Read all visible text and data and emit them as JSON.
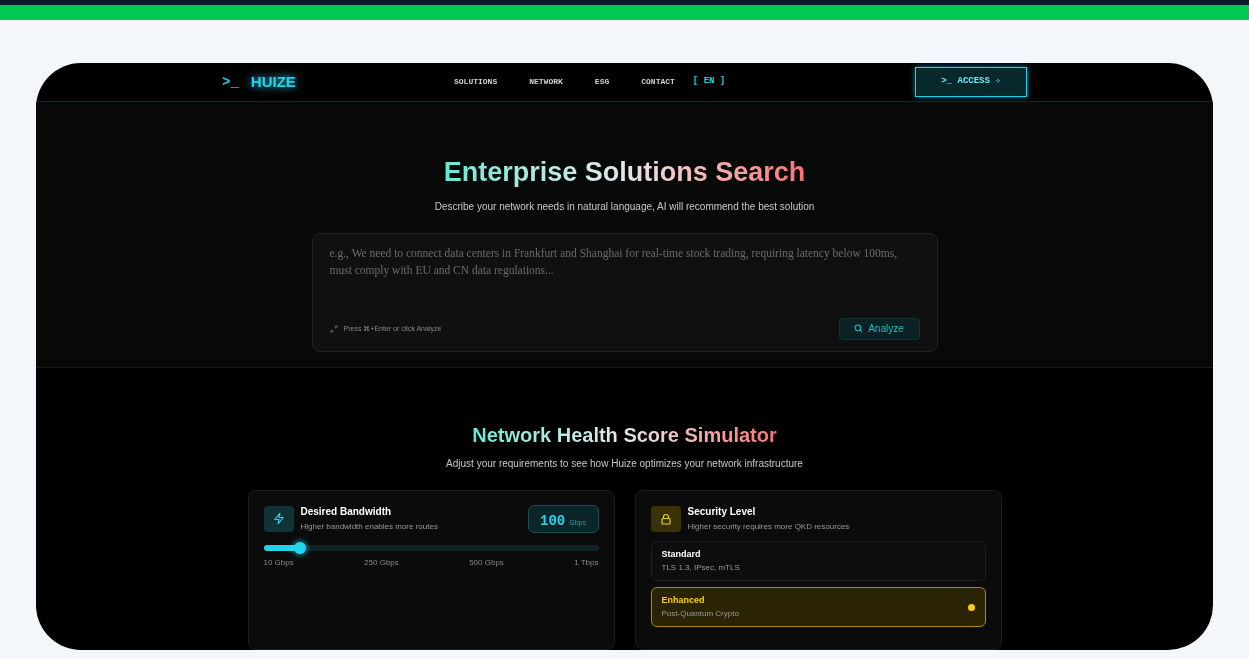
{
  "header": {
    "logo_prompt": ">_",
    "logo": "HUIZE",
    "nav": [
      {
        "label": "SOLUTIONS"
      },
      {
        "label": "NETWORK"
      },
      {
        "label": "ESG"
      },
      {
        "label": "CONTACT"
      }
    ],
    "language": "[ EN ]",
    "access_button": ">_ ACCESS ✧"
  },
  "search": {
    "title": "Enterprise Solutions Search",
    "subtitle": "Describe your network needs in natural language, AI will recommend the best solution",
    "placeholder": "e.g., We need to connect data centers in Frankfurt and Shanghai for real-time stock trading, requiring latency below 100ms, must comply with EU and CN data regulations...",
    "hint": "Press ⌘+Enter or click Analyze",
    "button": "Analyze"
  },
  "simulator": {
    "title": "Network Health Score Simulator",
    "subtitle": "Adjust your requirements to see how Huize optimizes your network infrastructure",
    "bandwidth": {
      "title": "Desired Bandwidth",
      "description": "Higher bandwidth enables more routes",
      "value": "100",
      "unit": "Gbps",
      "level": 0.11,
      "ticks": [
        "10 Gbps",
        "250 Gbps",
        "500 Gbps",
        "1 Tbps"
      ]
    },
    "security": {
      "title": "Security Level",
      "description": "Higher security requires more QKD resources",
      "options": [
        {
          "name": "Standard",
          "detail": "TLS 1.3, IPsec, mTLS",
          "selected": false
        },
        {
          "name": "Enhanced",
          "detail": "Post-Quantum Crypto",
          "selected": true
        }
      ]
    }
  }
}
